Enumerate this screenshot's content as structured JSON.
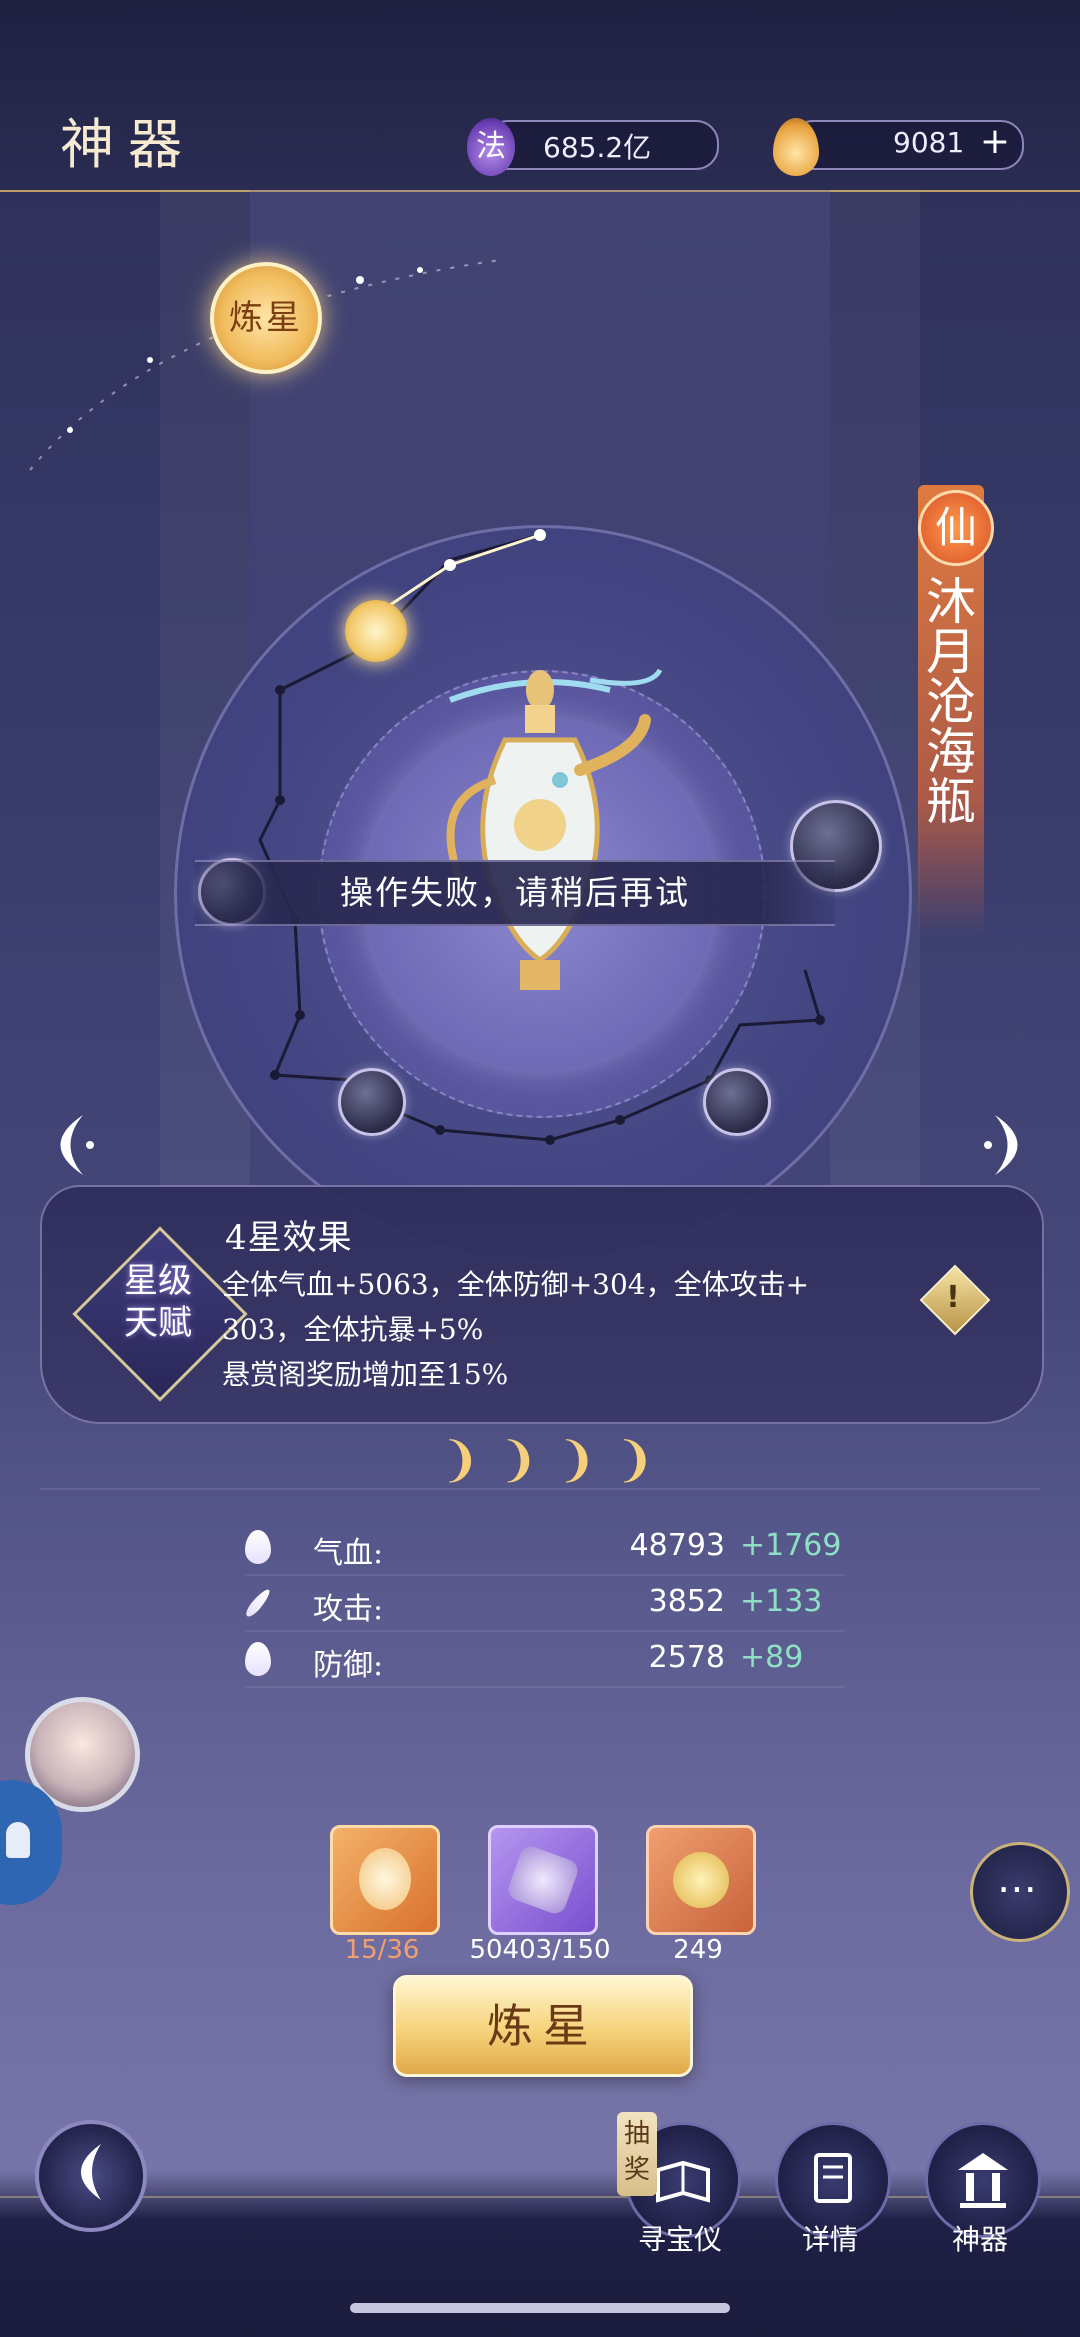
{
  "header": {
    "title": "神器",
    "mana": {
      "icon": "fa-token-icon",
      "icon_text": "法",
      "value": "685.2亿"
    },
    "gold": {
      "icon": "gold-flame-icon",
      "value": "9081"
    },
    "plus": "+"
  },
  "scene": {
    "star_button": "炼星",
    "toast": "操作失败，请稍后再试",
    "artifact": {
      "grade": "仙",
      "name": "沐月沧海瓶"
    }
  },
  "talent": {
    "badge": "星级\n天赋",
    "title": "4星效果",
    "lines": [
      "全体气血+5063，全体防御+304，全体攻击+",
      "303，全体抗暴+5%",
      "悬赏阁奖励增加至15%"
    ],
    "info": "!"
  },
  "stars": {
    "count": 4,
    "glyphs": "❩❩❩❩"
  },
  "stats": [
    {
      "icon": "blood-drop-icon",
      "label": "气血:",
      "value": "48793",
      "add": "+1769"
    },
    {
      "icon": "sword-icon",
      "label": "攻击:",
      "value": "3852",
      "add": "+133"
    },
    {
      "icon": "shield-leaf-icon",
      "label": "防御:",
      "value": "2578",
      "add": "+89"
    }
  ],
  "materials": [
    {
      "icon": "vase-shard-icon",
      "count": "15/36",
      "count_color": "#f0a070"
    },
    {
      "icon": "star-crystal-icon",
      "count": "50403/150",
      "count_color": "#ffffff"
    },
    {
      "icon": "gold-coin-icon",
      "count": "249",
      "count_color": "#ffffff"
    }
  ],
  "refine_button": "炼星",
  "nav": {
    "back": "back-arrow-icon",
    "lottery_tag": "抽奖",
    "items": [
      {
        "icon": "treasure-book-icon",
        "label": "寻宝仪"
      },
      {
        "icon": "details-card-icon",
        "label": "详情"
      },
      {
        "icon": "shrine-icon",
        "label": "神器"
      }
    ]
  },
  "colors": {
    "accent_gold": "#f5cf7a",
    "stat_add": "#8de0c4",
    "banner_orange": "#e0703a"
  }
}
